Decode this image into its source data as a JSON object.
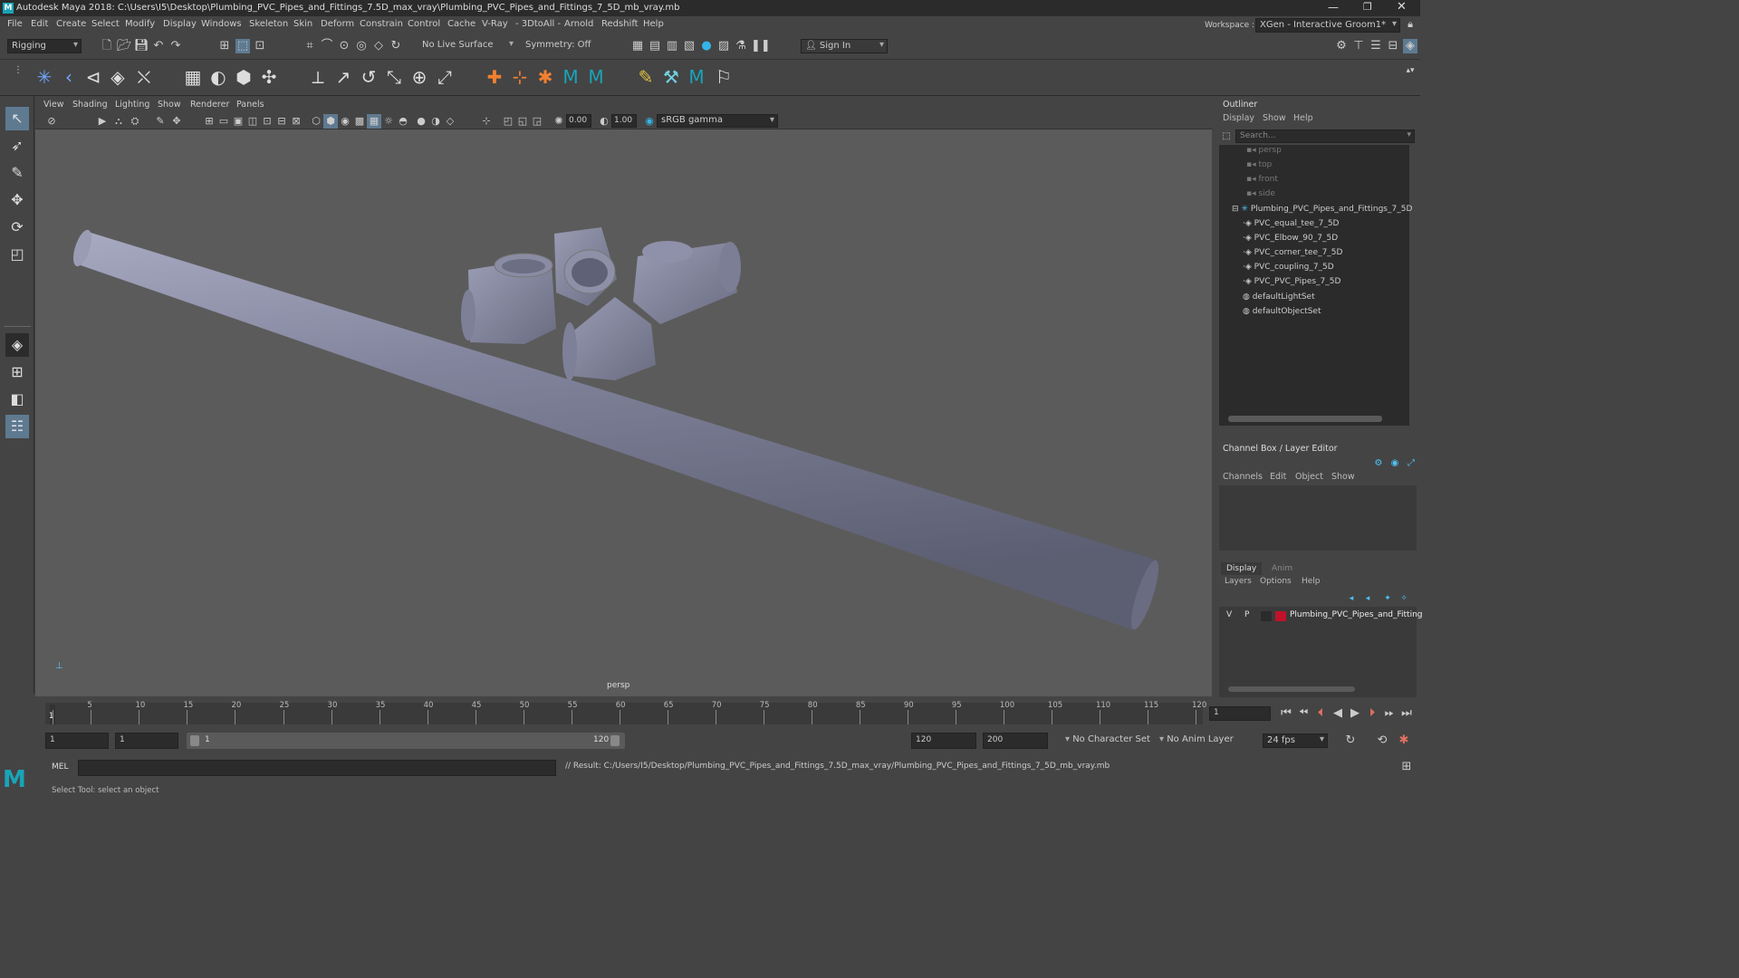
{
  "titlebar": {
    "title": "Autodesk Maya 2018: C:\\Users\\I5\\Desktop\\Plumbing_PVC_Pipes_and_Fittings_7.5D_max_vray\\Plumbing_PVC_Pipes_and_Fittings_7_5D_mb_vray.mb"
  },
  "menubar": {
    "items": [
      "File",
      "Edit",
      "Create",
      "Select",
      "Modify",
      "Display",
      "Windows",
      "Skeleton",
      "Skin",
      "Deform",
      "Constrain",
      "Control",
      "Cache",
      "V-Ray",
      "- 3DtoAll -",
      "Arnold",
      "Redshift",
      "Help"
    ],
    "workspace_label": "Workspace :",
    "workspace_value": "XGen - Interactive Groom1*"
  },
  "statusline": {
    "mode": "Rigging",
    "live_surface": "No Live Surface",
    "symmetry": "Symmetry: Off",
    "sign_in": "Sign In"
  },
  "viewport": {
    "menu": [
      "View",
      "Shading",
      "Lighting",
      "Show",
      "Renderer",
      "Panels"
    ],
    "near": "0.00",
    "far": "1.00",
    "color_space": "sRGB gamma",
    "camera": "persp"
  },
  "outliner": {
    "title": "Outliner",
    "menu": [
      "Display",
      "Show",
      "Help"
    ],
    "search_placeholder": "Search...",
    "items": [
      {
        "label": "persp",
        "dim": true
      },
      {
        "label": "top",
        "dim": true
      },
      {
        "label": "front",
        "dim": true
      },
      {
        "label": "side",
        "dim": true
      },
      {
        "label": "Plumbing_PVC_Pipes_and_Fittings_7_5D",
        "dim": false
      },
      {
        "label": "PVC_equal_tee_7_5D",
        "dim": false
      },
      {
        "label": "PVC_Elbow_90_7_5D",
        "dim": false
      },
      {
        "label": "PVC_corner_tee_7_5D",
        "dim": false
      },
      {
        "label": "PVC_coupling_7_5D",
        "dim": false
      },
      {
        "label": "PVC_PVC_Pipes_7_5D",
        "dim": false
      },
      {
        "label": "defaultLightSet",
        "dim": false
      },
      {
        "label": "defaultObjectSet",
        "dim": false
      }
    ]
  },
  "channelbox": {
    "title": "Channel Box / Layer Editor",
    "menu": [
      "Channels",
      "Edit",
      "Object",
      "Show"
    ]
  },
  "layereditor": {
    "tabs": [
      "Display",
      "Anim"
    ],
    "menu": [
      "Layers",
      "Options",
      "Help"
    ],
    "layer": {
      "v": "V",
      "p": "P",
      "name": "Plumbing_PVC_Pipes_and_Fitting",
      "color": "#c0112b"
    }
  },
  "timeline": {
    "ticks": [
      "1",
      "5",
      "10",
      "15",
      "20",
      "25",
      "30",
      "35",
      "40",
      "45",
      "50",
      "55",
      "60",
      "65",
      "70",
      "75",
      "80",
      "85",
      "90",
      "95",
      "100",
      "105",
      "110",
      "115",
      "120"
    ],
    "current_frame": "1",
    "field_frame": "1"
  },
  "range": {
    "start": "1",
    "playback_start": "1",
    "slider_start": "1",
    "slider_end": "120",
    "playback_end": "120",
    "end": "200",
    "character_set": "No Character Set",
    "anim_layer": "No Anim Layer",
    "fps": "24 fps"
  },
  "cmd": {
    "lang": "MEL",
    "result": "// Result: C:/Users/I5/Desktop/Plumbing_PVC_Pipes_and_Fittings_7.5D_max_vray/Plumbing_PVC_Pipes_and_Fittings_7_5D_mb_vray.mb"
  },
  "help": {
    "text": "Select Tool: select an object"
  }
}
